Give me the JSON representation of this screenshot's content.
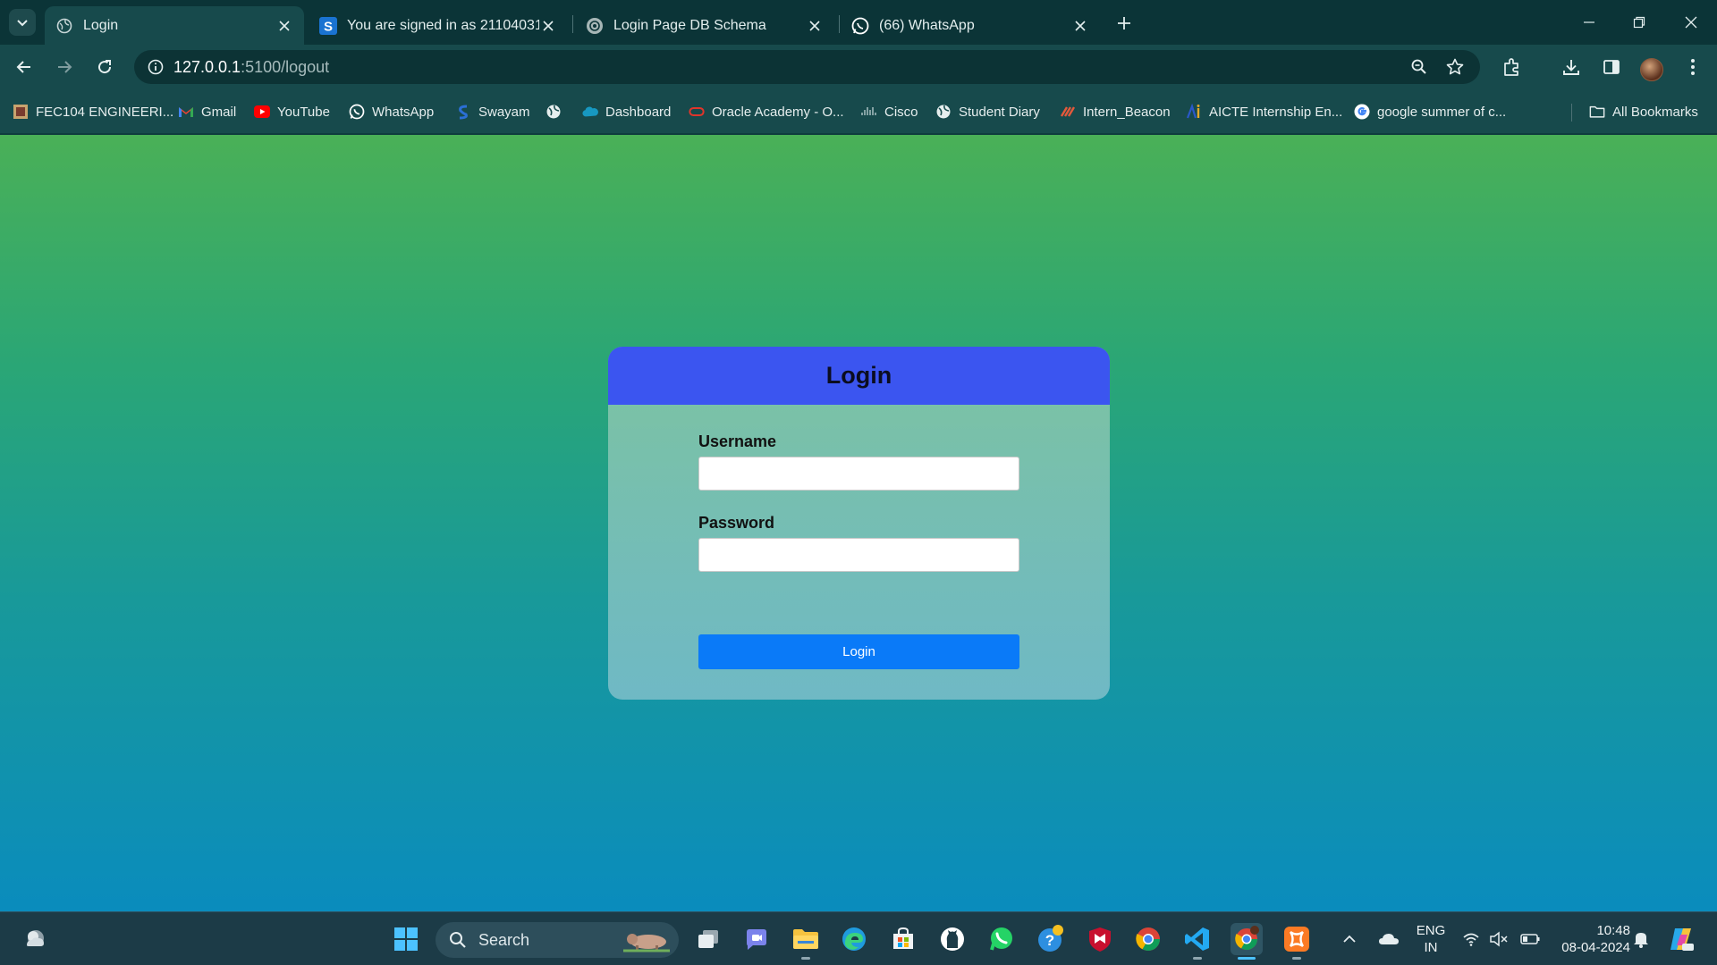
{
  "browser": {
    "tabs": [
      {
        "title": "Login",
        "favicon": "globe-icon",
        "active": true
      },
      {
        "title": "You are signed in as 21104031",
        "favicon": "s-logo-icon",
        "active": false
      },
      {
        "title": "Login Page DB Schema",
        "favicon": "chatgpt-icon",
        "active": false
      },
      {
        "title": "(66) WhatsApp",
        "favicon": "whatsapp-icon",
        "active": false
      }
    ],
    "url_host": "127.0.0.1",
    "url_path": ":5100/logout",
    "bookmarks": [
      {
        "label": "FEC104 ENGINEERI...",
        "icon": "college-icon"
      },
      {
        "label": "Gmail",
        "icon": "gmail-icon"
      },
      {
        "label": "YouTube",
        "icon": "youtube-icon"
      },
      {
        "label": "WhatsApp",
        "icon": "whatsapp-icon"
      },
      {
        "label": "Swayam",
        "icon": "swayam-icon"
      },
      {
        "label": "",
        "icon": "globe-icon"
      },
      {
        "label": "Dashboard",
        "icon": "salesforce-cloud-icon"
      },
      {
        "label": "Oracle Academy - O...",
        "icon": "oracle-icon"
      },
      {
        "label": "Cisco",
        "icon": "cisco-icon"
      },
      {
        "label": "Student Diary",
        "icon": "globe-icon"
      },
      {
        "label": "Intern_Beacon",
        "icon": "beacon-icon"
      },
      {
        "label": "AICTE Internship En...",
        "icon": "aicte-icon"
      },
      {
        "label": "google summer of c...",
        "icon": "google-icon"
      }
    ],
    "all_bookmarks_label": "All Bookmarks"
  },
  "login": {
    "title": "Login",
    "username_label": "Username",
    "username_value": "",
    "password_label": "Password",
    "password_value": "",
    "submit_label": "Login"
  },
  "taskbar": {
    "search_label": "Search",
    "lang_top": "ENG",
    "lang_bottom": "IN",
    "time": "10:48",
    "date": "08-04-2024"
  },
  "colors": {
    "header_blue": "#3b55f0",
    "button_blue": "#0a7af8",
    "page_gradient_top": "#4ab057",
    "page_gradient_bottom": "#0a8cbd"
  }
}
